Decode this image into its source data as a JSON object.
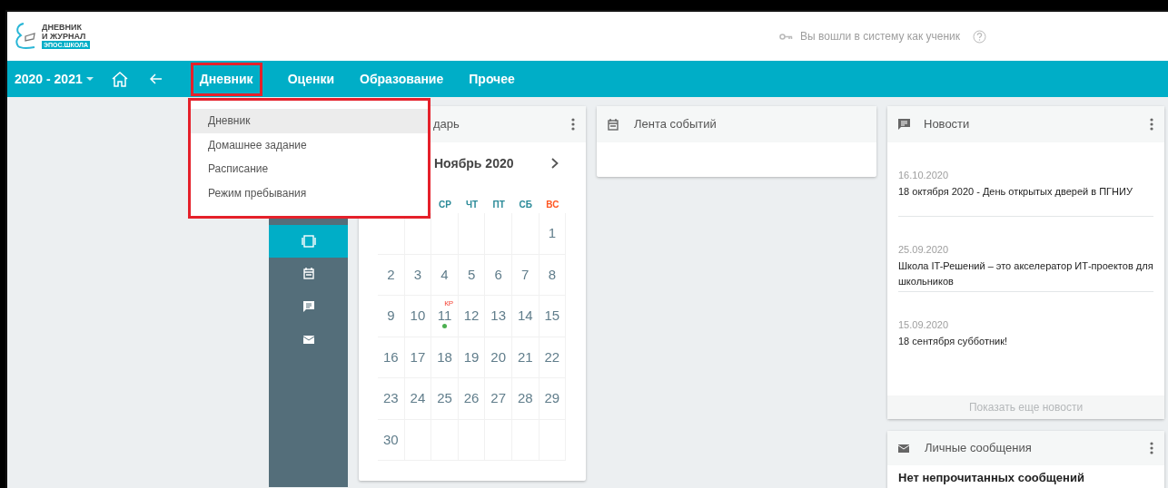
{
  "logo": {
    "line_1": "ДНЕВНИК",
    "line_2": "И ЖУРНАЛ",
    "tag": "ЭПОС.ШКОЛА"
  },
  "login_status": "Вы вошли в систему как ученик",
  "nav": {
    "year": "2020 - 2021",
    "tabs": [
      {
        "label": "Дневник",
        "selected": true
      },
      {
        "label": "Оценки",
        "selected": false
      },
      {
        "label": "Образование",
        "selected": false
      },
      {
        "label": "Прочее",
        "selected": false
      }
    ]
  },
  "dropdown": {
    "open": true,
    "items": [
      {
        "label": "Дневник",
        "selected": true
      },
      {
        "label": "Домашнее задание",
        "selected": false
      },
      {
        "label": "Расписание",
        "selected": false
      },
      {
        "label": "Режим пребывания",
        "selected": false
      }
    ]
  },
  "side_rail": [
    {
      "kind": "view",
      "selected": true
    },
    {
      "kind": "calendar",
      "selected": false
    },
    {
      "kind": "news",
      "selected": false
    },
    {
      "kind": "mail",
      "selected": false
    }
  ],
  "calendar": {
    "title": "дарь",
    "month": "Ноябрь 2020",
    "weekdays": [
      {
        "label": "СР",
        "weekend": false
      },
      {
        "label": "ЧТ",
        "weekend": false
      },
      {
        "label": "ПТ",
        "weekend": false
      },
      {
        "label": "СБ",
        "weekend": false
      },
      {
        "label": "ВС",
        "weekend": true
      }
    ],
    "weeks": [
      [
        {
          "day": "1",
          "event": false
        }
      ],
      [
        {
          "day": "2",
          "event": false
        },
        {
          "day": "3",
          "event": false
        },
        {
          "day": "4",
          "event": false
        },
        {
          "day": "5",
          "event": false
        },
        {
          "day": "6",
          "event": false
        },
        {
          "day": "7",
          "event": false
        },
        {
          "day": "8",
          "event": false
        }
      ],
      [
        {
          "day": "9",
          "event": false
        },
        {
          "day": "10",
          "event": false
        },
        {
          "day": "11",
          "event": true,
          "tag": "КР"
        },
        {
          "day": "12",
          "event": false
        },
        {
          "day": "13",
          "event": false
        },
        {
          "day": "14",
          "event": false
        },
        {
          "day": "15",
          "event": false
        }
      ],
      [
        {
          "day": "16",
          "event": false
        },
        {
          "day": "17",
          "event": false
        },
        {
          "day": "18",
          "event": false
        },
        {
          "day": "19",
          "event": false
        },
        {
          "day": "20",
          "event": false
        },
        {
          "day": "21",
          "event": false
        },
        {
          "day": "22",
          "event": false
        }
      ],
      [
        {
          "day": "23",
          "event": false
        },
        {
          "day": "24",
          "event": false
        },
        {
          "day": "25",
          "event": false
        },
        {
          "day": "26",
          "event": false
        },
        {
          "day": "27",
          "event": false
        },
        {
          "day": "28",
          "event": false
        },
        {
          "day": "29",
          "event": false
        }
      ],
      [
        {
          "day": "30",
          "event": false
        }
      ]
    ]
  },
  "events": {
    "title": "Лента событий"
  },
  "news": {
    "title": "Новости",
    "items": [
      {
        "date": "16.10.2020",
        "text": "18 октября 2020 - День открытых дверей в ПГНИУ"
      },
      {
        "date": "25.09.2020",
        "text": "Школа IT-Решений – это акселератор ИТ-проектов для школьников"
      },
      {
        "date": "15.09.2020",
        "text": "18 сентября субботник!"
      }
    ],
    "more": "Показать еще новости"
  },
  "messages": {
    "title": "Личные сообщения",
    "empty": "Нет непрочитанных сообщений"
  }
}
